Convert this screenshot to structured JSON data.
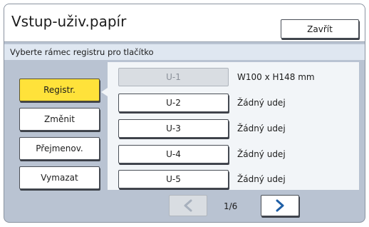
{
  "window": {
    "title": "Vstup-uživ.papír",
    "close_label": "Zavřít"
  },
  "instruction": "Vyberte rámec registru pro tlačítko",
  "actions": [
    {
      "label": "Registr.",
      "active": true
    },
    {
      "label": "Změnit",
      "active": false
    },
    {
      "label": "Přejmenov.",
      "active": false
    },
    {
      "label": "Vymazat",
      "active": false
    }
  ],
  "slots": [
    {
      "label": "U-1",
      "description": "W100 x H148 mm",
      "disabled": true
    },
    {
      "label": "U-2",
      "description": "Žádný udej",
      "disabled": false
    },
    {
      "label": "U-3",
      "description": "Žádný udej",
      "disabled": false
    },
    {
      "label": "U-4",
      "description": "Žádný udej",
      "disabled": false
    },
    {
      "label": "U-5",
      "description": "Žádný udej",
      "disabled": false
    }
  ],
  "pagination": {
    "page_text": "1/6",
    "prev_icon": "chevron-left-icon",
    "next_icon": "chevron-right-icon",
    "prev_disabled": true
  },
  "colors": {
    "active": "#ffe23a",
    "accent": "#1f5fa6",
    "disabled_icon": "#a7b0bd"
  }
}
